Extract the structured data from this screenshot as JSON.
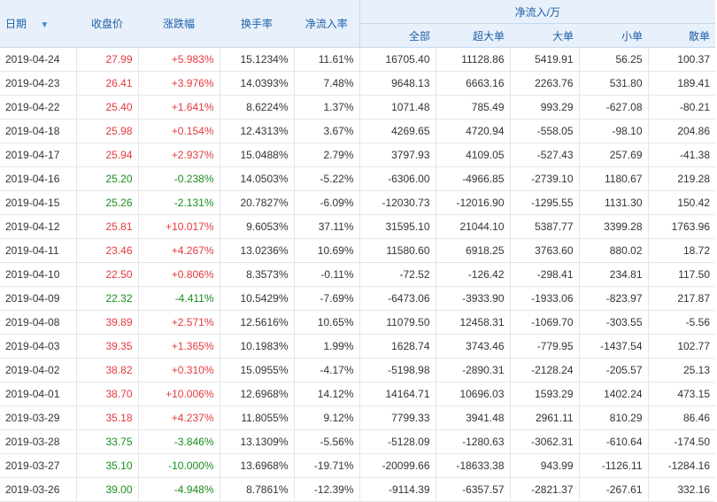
{
  "headers": {
    "date": "日期",
    "close": "收盘价",
    "change_pct": "涨跌幅",
    "turnover": "换手率",
    "net_inflow_rate": "净流入率",
    "net_inflow_group": "净流入/万",
    "total": "全部",
    "super_large": "超大单",
    "large": "大单",
    "small": "小单",
    "retail": "散单"
  },
  "colors": {
    "up": "#e4393c",
    "down": "#1a8c1a",
    "header_bg": "#e8f1fb",
    "header_text": "#1e5fa8"
  },
  "sort_icon": "sort-down-arrow-icon",
  "rows": [
    {
      "date": "2019-04-24",
      "close": "27.99",
      "change": "+5.983%",
      "turnover": "15.1234%",
      "rate": "11.61%",
      "total": "16705.40",
      "super": "11128.86",
      "large": "5419.91",
      "small": "56.25",
      "retail": "100.37",
      "dir": "up"
    },
    {
      "date": "2019-04-23",
      "close": "26.41",
      "change": "+3.976%",
      "turnover": "14.0393%",
      "rate": "7.48%",
      "total": "9648.13",
      "super": "6663.16",
      "large": "2263.76",
      "small": "531.80",
      "retail": "189.41",
      "dir": "up"
    },
    {
      "date": "2019-04-22",
      "close": "25.40",
      "change": "+1.641%",
      "turnover": "8.6224%",
      "rate": "1.37%",
      "total": "1071.48",
      "super": "785.49",
      "large": "993.29",
      "small": "-627.08",
      "retail": "-80.21",
      "dir": "up"
    },
    {
      "date": "2019-04-18",
      "close": "25.98",
      "change": "+0.154%",
      "turnover": "12.4313%",
      "rate": "3.67%",
      "total": "4269.65",
      "super": "4720.94",
      "large": "-558.05",
      "small": "-98.10",
      "retail": "204.86",
      "dir": "up"
    },
    {
      "date": "2019-04-17",
      "close": "25.94",
      "change": "+2.937%",
      "turnover": "15.0488%",
      "rate": "2.79%",
      "total": "3797.93",
      "super": "4109.05",
      "large": "-527.43",
      "small": "257.69",
      "retail": "-41.38",
      "dir": "up"
    },
    {
      "date": "2019-04-16",
      "close": "25.20",
      "change": "-0.238%",
      "turnover": "14.0503%",
      "rate": "-5.22%",
      "total": "-6306.00",
      "super": "-4966.85",
      "large": "-2739.10",
      "small": "1180.67",
      "retail": "219.28",
      "dir": "down"
    },
    {
      "date": "2019-04-15",
      "close": "25.26",
      "change": "-2.131%",
      "turnover": "20.7827%",
      "rate": "-6.09%",
      "total": "-12030.73",
      "super": "-12016.90",
      "large": "-1295.55",
      "small": "1131.30",
      "retail": "150.42",
      "dir": "down"
    },
    {
      "date": "2019-04-12",
      "close": "25.81",
      "change": "+10.017%",
      "turnover": "9.6053%",
      "rate": "37.11%",
      "total": "31595.10",
      "super": "21044.10",
      "large": "5387.77",
      "small": "3399.28",
      "retail": "1763.96",
      "dir": "up"
    },
    {
      "date": "2019-04-11",
      "close": "23.46",
      "change": "+4.267%",
      "turnover": "13.0236%",
      "rate": "10.69%",
      "total": "11580.60",
      "super": "6918.25",
      "large": "3763.60",
      "small": "880.02",
      "retail": "18.72",
      "dir": "up"
    },
    {
      "date": "2019-04-10",
      "close": "22.50",
      "change": "+0.806%",
      "turnover": "8.3573%",
      "rate": "-0.11%",
      "total": "-72.52",
      "super": "-126.42",
      "large": "-298.41",
      "small": "234.81",
      "retail": "117.50",
      "dir": "up"
    },
    {
      "date": "2019-04-09",
      "close": "22.32",
      "change": "-4.411%",
      "turnover": "10.5429%",
      "rate": "-7.69%",
      "total": "-6473.06",
      "super": "-3933.90",
      "large": "-1933.06",
      "small": "-823.97",
      "retail": "217.87",
      "dir": "down"
    },
    {
      "date": "2019-04-08",
      "close": "39.89",
      "change": "+2.571%",
      "turnover": "12.5616%",
      "rate": "10.65%",
      "total": "11079.50",
      "super": "12458.31",
      "large": "-1069.70",
      "small": "-303.55",
      "retail": "-5.56",
      "dir": "up"
    },
    {
      "date": "2019-04-03",
      "close": "39.35",
      "change": "+1.365%",
      "turnover": "10.1983%",
      "rate": "1.99%",
      "total": "1628.74",
      "super": "3743.46",
      "large": "-779.95",
      "small": "-1437.54",
      "retail": "102.77",
      "dir": "up"
    },
    {
      "date": "2019-04-02",
      "close": "38.82",
      "change": "+0.310%",
      "turnover": "15.0955%",
      "rate": "-4.17%",
      "total": "-5198.98",
      "super": "-2890.31",
      "large": "-2128.24",
      "small": "-205.57",
      "retail": "25.13",
      "dir": "up"
    },
    {
      "date": "2019-04-01",
      "close": "38.70",
      "change": "+10.006%",
      "turnover": "12.6968%",
      "rate": "14.12%",
      "total": "14164.71",
      "super": "10696.03",
      "large": "1593.29",
      "small": "1402.24",
      "retail": "473.15",
      "dir": "up"
    },
    {
      "date": "2019-03-29",
      "close": "35.18",
      "change": "+4.237%",
      "turnover": "11.8055%",
      "rate": "9.12%",
      "total": "7799.33",
      "super": "3941.48",
      "large": "2961.11",
      "small": "810.29",
      "retail": "86.46",
      "dir": "up"
    },
    {
      "date": "2019-03-28",
      "close": "33.75",
      "change": "-3.846%",
      "turnover": "13.1309%",
      "rate": "-5.56%",
      "total": "-5128.09",
      "super": "-1280.63",
      "large": "-3062.31",
      "small": "-610.64",
      "retail": "-174.50",
      "dir": "down"
    },
    {
      "date": "2019-03-27",
      "close": "35.10",
      "change": "-10.000%",
      "turnover": "13.6968%",
      "rate": "-19.71%",
      "total": "-20099.66",
      "super": "-18633.38",
      "large": "943.99",
      "small": "-1126.11",
      "retail": "-1284.16",
      "dir": "down"
    },
    {
      "date": "2019-03-26",
      "close": "39.00",
      "change": "-4.948%",
      "turnover": "8.7861%",
      "rate": "-12.39%",
      "total": "-9114.39",
      "super": "-6357.57",
      "large": "-2821.37",
      "small": "-267.61",
      "retail": "332.16",
      "dir": "down"
    }
  ]
}
